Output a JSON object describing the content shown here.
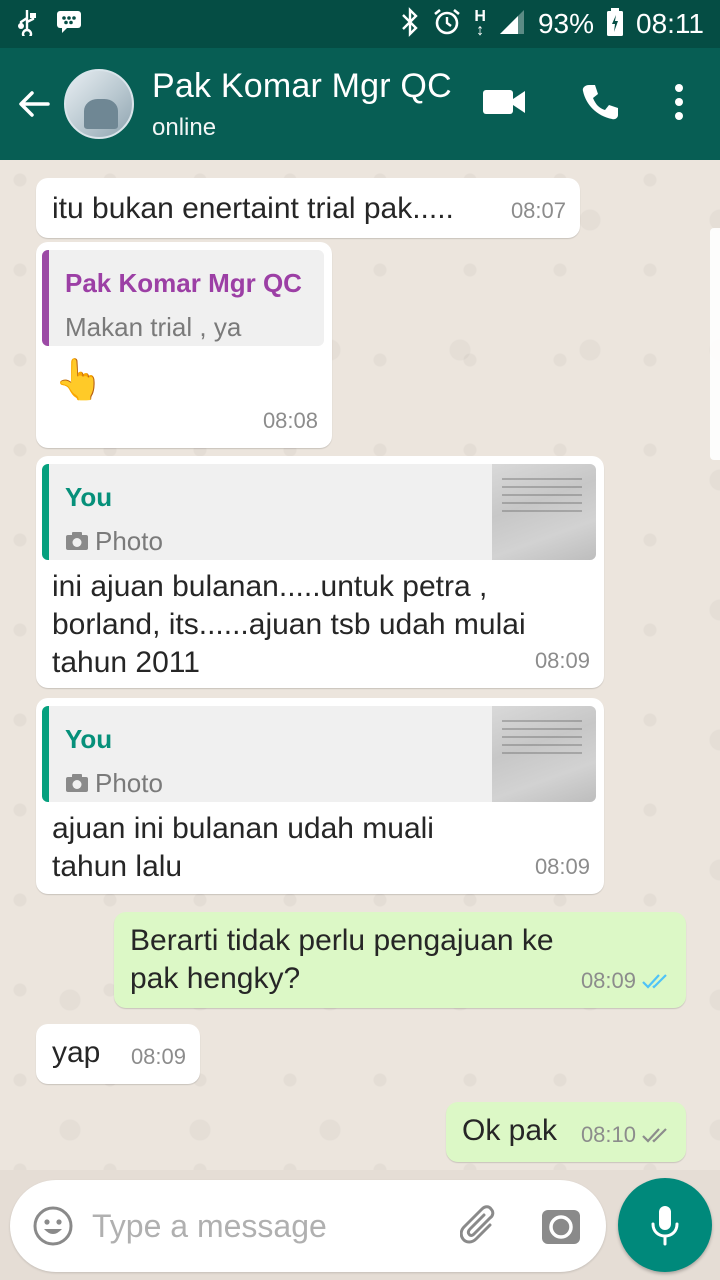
{
  "status_bar": {
    "battery": "93%",
    "time": "08:11",
    "network": "H"
  },
  "header": {
    "contact_name": "Pak Komar Mgr QC",
    "contact_status": "online"
  },
  "messages": [
    {
      "text": "itu bukan enertaint trial pak.....",
      "time": "08:07"
    },
    {
      "quote_name": "Pak Komar Mgr QC",
      "quote_text": "Makan trial , ya",
      "emoji": "👆",
      "time": "08:08"
    },
    {
      "quote_name": "You",
      "quote_text": "Photo",
      "text": "ini ajuan bulanan.....untuk petra , borland, its......ajuan tsb udah mulai tahun 2011",
      "time": "08:09"
    },
    {
      "quote_name": "You",
      "quote_text": "Photo",
      "text": "ajuan ini bulanan udah muali tahun lalu",
      "time": "08:09"
    },
    {
      "text": "Berarti tidak perlu pengajuan ke pak hengky?",
      "time": "08:09",
      "read": true
    },
    {
      "text": "yap",
      "time": "08:09"
    },
    {
      "text": "Ok pak",
      "time": "08:10",
      "read": false
    }
  ],
  "input": {
    "placeholder": "Type a message"
  },
  "colors": {
    "header": "#075e54",
    "status_bar": "#054d44",
    "outgoing_bubble": "#dcf8c6",
    "read_ticks": "#4fc3f7",
    "mic_button": "#00897b"
  },
  "icons": [
    "back-arrow-icon",
    "video-call-icon",
    "phone-icon",
    "menu-dots-icon",
    "emoji-icon",
    "attach-icon",
    "camera-icon",
    "mic-icon",
    "bluetooth-icon",
    "alarm-icon",
    "signal-icon",
    "battery-icon"
  ]
}
